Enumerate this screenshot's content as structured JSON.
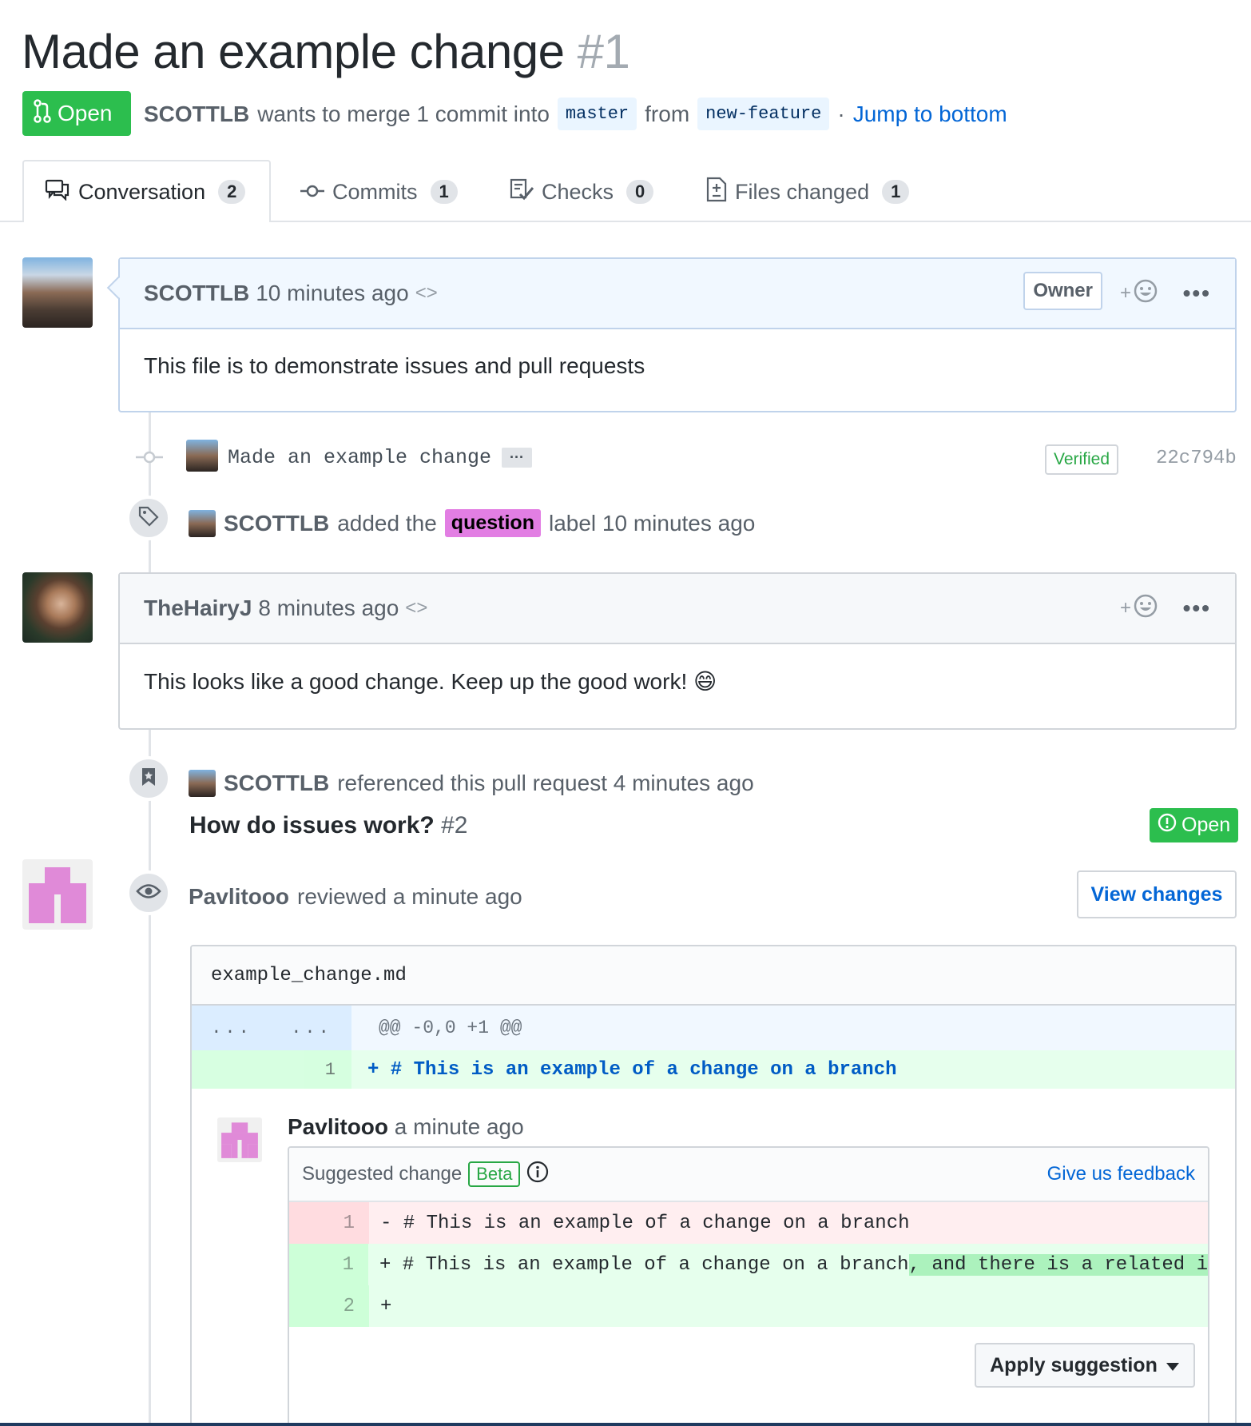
{
  "header": {
    "title": "Made an example change",
    "number": "#1",
    "state": "Open",
    "author": "SCOTTLB",
    "merge_text": "wants to merge 1 commit into",
    "base_branch": "master",
    "from_text": "from",
    "head_branch": "new-feature",
    "jump_link": "Jump to bottom"
  },
  "tabs": [
    {
      "label": "Conversation",
      "count": "2",
      "icon": "comment-discussion-icon"
    },
    {
      "label": "Commits",
      "count": "1",
      "icon": "git-commit-icon"
    },
    {
      "label": "Checks",
      "count": "0",
      "icon": "checklist-icon"
    },
    {
      "label": "Files changed",
      "count": "1",
      "icon": "file-diff-icon"
    }
  ],
  "comments": [
    {
      "author": "SCOTTLB",
      "time": "10 minutes ago",
      "badge": "Owner",
      "body": "This file is to demonstrate issues and pull requests"
    },
    {
      "author": "TheHairyJ",
      "time": "8 minutes ago",
      "body": "This looks like a good change. Keep up the good work! 😄"
    }
  ],
  "commit": {
    "message": "Made an example change",
    "verified": "Verified",
    "sha": "22c794b"
  },
  "label_event": {
    "author": "SCOTTLB",
    "text_before": "added the",
    "label": "question",
    "text_after": "label 10 minutes ago",
    "label_color": "#e27ee3"
  },
  "ref_event": {
    "author": "SCOTTLB",
    "text": "referenced this pull request 4 minutes ago",
    "issue_title": "How do issues work?",
    "issue_number": "#2",
    "issue_state": "Open"
  },
  "review": {
    "author": "Pavlitooo",
    "text": "reviewed a minute ago",
    "view_changes": "View changes",
    "file": "example_change.md",
    "hunk": "@@ -0,0 +1 @@",
    "hunk_gutter_left": "...",
    "hunk_gutter_right": "...",
    "added_line_no": "1",
    "added_line": "+ # This is an example of a change on a branch",
    "comment_author": "Pavlitooo",
    "comment_time": "a minute ago",
    "suggested_label": "Suggested change",
    "beta": "Beta",
    "feedback": "Give us feedback",
    "del_no": "1",
    "del_line": "- # This is an example of a change on a branch",
    "add_no": "1",
    "add_line_prefix": "+ # This is an example of a change on a branch",
    "add_line_highlight": ", and there is a related i",
    "add2_no": "2",
    "add2_line": "+",
    "apply_button": "Apply suggestion"
  },
  "colors": {
    "green": "#2cbe4e",
    "blue": "#0366d6",
    "label": "#e27ee3"
  }
}
